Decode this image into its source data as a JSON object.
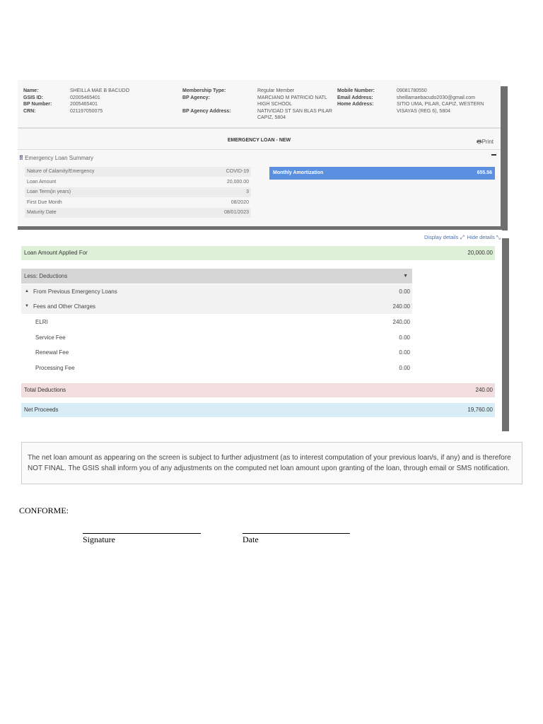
{
  "member": {
    "name_label": "Name:",
    "name": "SHEILLA MAE B BACUDO",
    "gsis_label": "GSIS ID:",
    "gsis": "02005465401",
    "bp_label": "BP Number:",
    "bp": "2005465401",
    "crn_label": "CRN:",
    "crn": "021197050075",
    "mtype_label": "Membership Type:",
    "mtype": "Regular Member",
    "agency_label": "BP Agency:",
    "agency": "MARCIANO M PATRICIO NATL HIGH SCHOOL",
    "agency_addr_label": "BP Agency Address:",
    "agency_addr": "NATIVIDAD ST SAN BLAS PILAR CAPIZ, 5804",
    "mobile_label": "Mobile Number:",
    "mobile": "09081780550",
    "email_label": "Email Address:",
    "email": "sheillamaebacudo2030@gmail.com",
    "home_label": "Home Address:",
    "home": "SITIO UMA, PILAR, CAPIZ, WESTERN VISAYAS (REG 6), 5804"
  },
  "title": "EMERGENCY LOAN - NEW",
  "print": "Print",
  "summary": {
    "title": "Emergency Loan Summary",
    "rows": [
      {
        "label": "Nature of Calamity/Emergency",
        "value": "COVID-19"
      },
      {
        "label": "Loan Amount",
        "value": "20,000.00"
      },
      {
        "label": "Loan Term(in years)",
        "value": "3"
      },
      {
        "label": "First Due Month",
        "value": "08/2020"
      },
      {
        "label": "Maturity Date",
        "value": "08/01/2023"
      }
    ],
    "amort_label": "Monthly Amortization",
    "amort_value": "655.56"
  },
  "breakdown": {
    "display_details": "Display details",
    "hide_details": "Hide details",
    "applied_label": "Loan Amount Applied For",
    "applied_value": "20,000.00",
    "less_label": "Less: Deductions",
    "prev_label": "From Previous Emergency Loans",
    "prev_value": "0.00",
    "fees_label": "Fees and Other Charges",
    "fees_value": "240.00",
    "items": [
      {
        "label": "ELRI",
        "value": "240.00"
      },
      {
        "label": "Service Fee",
        "value": "0.00"
      },
      {
        "label": "Renewal Fee",
        "value": "0.00"
      },
      {
        "label": "Processing Fee",
        "value": "0.00"
      }
    ],
    "total_label": "Total Deductions",
    "total_value": "240.00",
    "net_label": "Net Proceeds",
    "net_value": "19,760.00"
  },
  "note": "The net loan amount as appearing on the screen is subject to further adjustment (as to interest computation of your previous loan/s, if any) and is therefore NOT FINAL. The GSIS shall inform you of any adjustments on the computed net loan amount upon granting of the loan, through email or SMS notification.",
  "conforme": "CONFORME:",
  "signature": "Signature",
  "date": "Date"
}
